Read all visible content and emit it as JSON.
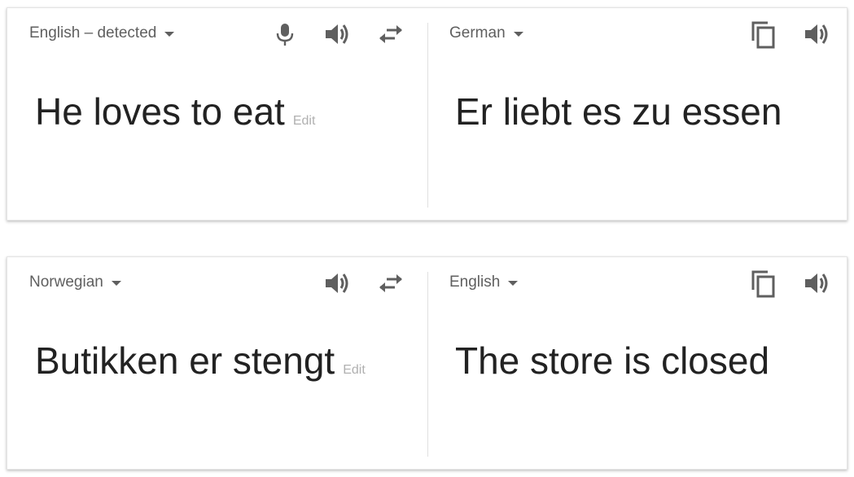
{
  "cards": [
    {
      "source": {
        "language": "English – detected",
        "text": "He loves to eat",
        "edit_label": "Edit"
      },
      "target": {
        "language": "German",
        "text": "Er liebt es zu essen"
      },
      "source_icons": [
        "microphone-icon",
        "speaker-icon",
        "swap-icon"
      ],
      "target_icons": [
        "copy-icon",
        "speaker-icon"
      ]
    },
    {
      "source": {
        "language": "Norwegian",
        "text": "Butikken er stengt",
        "edit_label": "Edit"
      },
      "target": {
        "language": "English",
        "text": "The store is closed"
      },
      "source_icons": [
        "speaker-icon",
        "swap-icon"
      ],
      "target_icons": [
        "copy-icon",
        "speaker-icon"
      ]
    }
  ],
  "colors": {
    "icon": "#5f5f5f",
    "text": "#222222",
    "edit": "#b0b0b0",
    "divider": "#e0e0e0"
  }
}
